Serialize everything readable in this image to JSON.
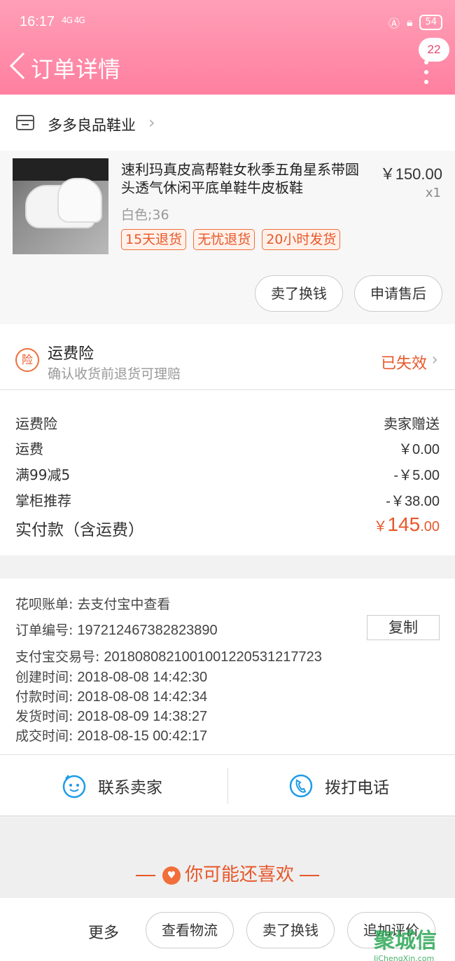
{
  "status_bar": {
    "time": "16:17",
    "signal": "4G 4G",
    "battery": "54"
  },
  "header": {
    "title": "订单详情",
    "badge": "22"
  },
  "shop": {
    "name": "多多良品鞋业"
  },
  "item": {
    "title": "速利玛真皮高帮鞋女秋季五角星系带圆头透气休闲平底单鞋牛皮板鞋",
    "price": "￥150.00",
    "qty": "x1",
    "spec": "白色;36",
    "tags": [
      "15天退货",
      "无忧退货",
      "20小时发货"
    ],
    "buttons": [
      "卖了换钱",
      "申请售后"
    ]
  },
  "insurance": {
    "icon_text": "险",
    "title": "运费险",
    "subtitle": "确认收货前退货可理赔",
    "status": "已失效"
  },
  "costs": [
    {
      "label": "运费险",
      "value": "卖家赠送"
    },
    {
      "label": "运费",
      "value": "￥0.00"
    },
    {
      "label": "满99减5",
      "value": "-￥5.00"
    },
    {
      "label": "掌柜推荐",
      "value": "-￥38.00"
    }
  ],
  "total": {
    "label": "实付款（含运费）",
    "currency": "￥",
    "integer": "145",
    "decimal": ".00"
  },
  "info": {
    "huabei": {
      "label": "花呗账单:",
      "value": "去支付宝中查看"
    },
    "order_no": {
      "label": "订单编号:",
      "value": "197212467382823890"
    },
    "copy_label": "复制",
    "alipay_no": {
      "label": "支付宝交易号:",
      "value": "2018080821001001220531217723"
    },
    "created": {
      "label": "创建时间:",
      "value": "2018-08-08 14:42:30"
    },
    "paid": {
      "label": "付款时间:",
      "value": "2018-08-08 14:42:34"
    },
    "shipped": {
      "label": "发货时间:",
      "value": "2018-08-09 14:38:27"
    },
    "completed": {
      "label": "成交时间:",
      "value": "2018-08-15 00:42:17"
    }
  },
  "contact": {
    "seller": "联系卖家",
    "phone": "拨打电话"
  },
  "recommend": {
    "title": "你可能还喜欢"
  },
  "bottom": {
    "more": "更多",
    "buttons": [
      "查看物流",
      "卖了换钱",
      "追加评价"
    ]
  },
  "watermark": {
    "logo": "聚城信",
    "url": "JiChengXin.com"
  },
  "colors": {
    "header_pink": "#ff8aa6",
    "accent_orange": "#e8572a",
    "badge_text": "#e2476b",
    "icon_blue": "#1e9be8"
  }
}
